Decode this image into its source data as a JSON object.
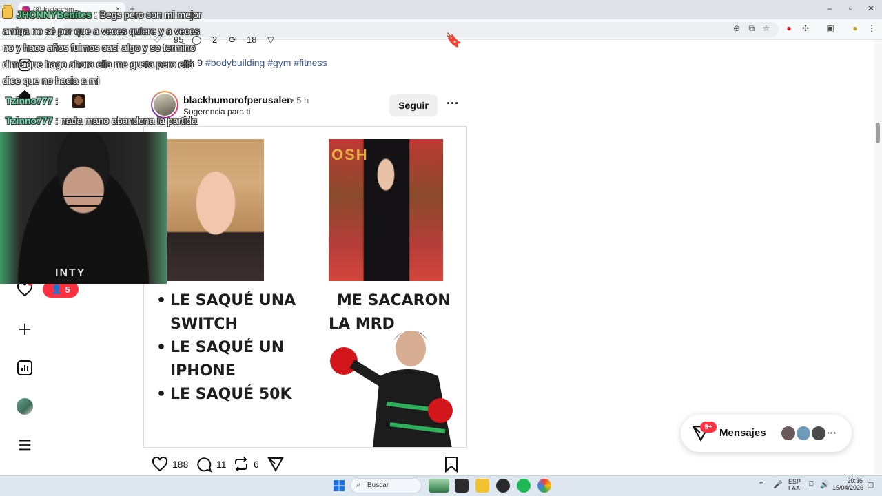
{
  "browser": {
    "tab_title": "(8) Instagram",
    "tab_close": "×",
    "new_tab": "+",
    "controls": {
      "minimize": "–",
      "maximize": "▫",
      "close": "✕"
    },
    "toolbar_icons": [
      "zoom-icon",
      "install-icon",
      "star-icon",
      "opera-icon",
      "extensions-icon",
      "sidebar-icon",
      "profile-icon",
      "menu-icon"
    ]
  },
  "prev_post": {
    "likes": "95",
    "comments": "2",
    "reposts": "18",
    "caption_prefix": "rd: 9",
    "caption_tags": "#bodybuilding #gym #fitness"
  },
  "post": {
    "username": "blackhumorofperusalen",
    "time": "• 5 h",
    "suggestion": "Sugerencia para ti",
    "follow_label": "Seguir",
    "more_label": "···",
    "meme": {
      "photo_sign_text": "OSH",
      "left_list": [
        "LE SAQUÉ UNA SWITCH",
        "LE SAQUÉ UN IPHONE",
        "LE SAQUÉ 50K"
      ],
      "right_line1": "ME SACARON",
      "right_line2": "LA MRD"
    },
    "likes": "188",
    "comments": "11",
    "reposts": "6"
  },
  "left_rail": {
    "notification_count": "5"
  },
  "webcam": {
    "shirt_text": "INTY"
  },
  "chat": {
    "msg1_user": "JHONNYBenites",
    "msg1_line1": ": Begs pero con mi mejor",
    "msg1_line2": "amiga no sé por que a veces quiere y a veces",
    "msg1_line3": "no y hace años fuimos casi algo y se termino",
    "msg1_line4": "dime que hago ahora ella me gusta pero ella",
    "msg1_line5": "dice que no hacia a mi",
    "msg2_user": "Tzinno777",
    "msg2_text": ":",
    "msg3_user": "Tzinno777",
    "msg3_text": ": nada mano abandona la partida"
  },
  "messages": {
    "label": "Mensajes",
    "badge": "9+",
    "more": "···"
  },
  "taskbar": {
    "search_placeholder": "Buscar",
    "lang_line1": "ESP",
    "lang_line2": "LAA",
    "time": "20:36",
    "date": "15/04/2026"
  }
}
